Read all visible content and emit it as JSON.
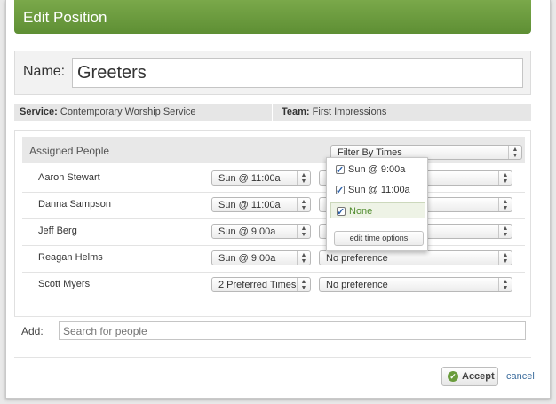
{
  "dialog": {
    "title": "Edit Position"
  },
  "name_field": {
    "label": "Name:",
    "value": "Greeters"
  },
  "info": {
    "service_label": "Service:",
    "service_value": "Contemporary Worship Service",
    "team_label": "Team:",
    "team_value": "First Impressions"
  },
  "assigned": {
    "heading": "Assigned People",
    "filter_selected": "Filter By Times",
    "rows": [
      {
        "name": "Aaron Stewart",
        "time": "Sun @ 11:00a",
        "preference": ""
      },
      {
        "name": "Danna Sampson",
        "time": "Sun @ 11:00a",
        "preference": ""
      },
      {
        "name": "Jeff Berg",
        "time": "Sun @ 9:00a",
        "preference": ""
      },
      {
        "name": "Reagan Helms",
        "time": "Sun @ 9:00a",
        "preference": "No preference"
      },
      {
        "name": "Scott Myers",
        "time": "2 Preferred Times",
        "preference": "No preference"
      }
    ]
  },
  "filter_dropdown": {
    "options": [
      {
        "label": "Sun @ 9:00a",
        "checked": true
      },
      {
        "label": "Sun @ 11:00a",
        "checked": true
      },
      {
        "label": "None",
        "checked": true
      }
    ],
    "edit_button": "edit time options"
  },
  "add": {
    "label": "Add:",
    "placeholder": "Search for people"
  },
  "footer": {
    "accept_label": "Accept",
    "cancel_label": "cancel"
  },
  "icons": {
    "select_arrows": "updown-arrows-icon",
    "checkbox": "checkbox-checked-icon",
    "accept": "check-circle-icon"
  },
  "colors": {
    "title_bar": "#6a9c3c",
    "link": "#3e6e9e",
    "none_option_text": "#4d8a2a"
  }
}
